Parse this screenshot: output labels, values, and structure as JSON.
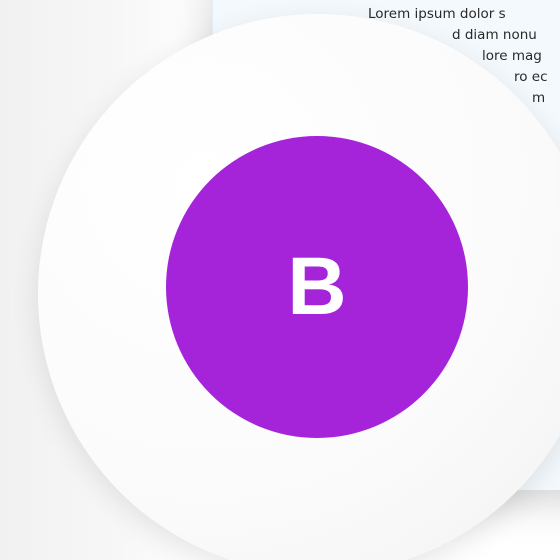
{
  "document": {
    "lines": [
      "Lorem ipsum dolor s",
      "d diam nonu",
      "lore mag",
      "ro ec",
      "m"
    ]
  },
  "avatar": {
    "initial": "B",
    "color": "#a524da"
  }
}
